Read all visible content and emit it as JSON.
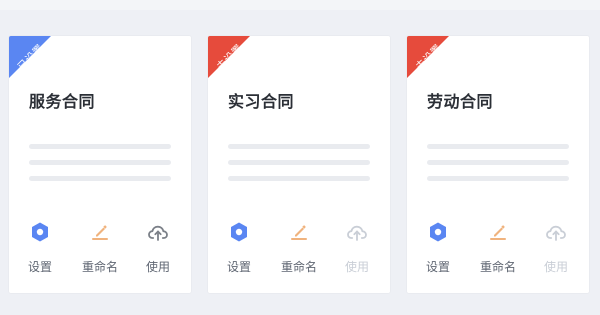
{
  "cards": [
    {
      "badge": "已设置",
      "title": "服务合同",
      "actions": {
        "settings_label": "设置",
        "rename_label": "重命名",
        "use_label": "使用"
      }
    },
    {
      "badge": "未设置",
      "title": "实习合同",
      "actions": {
        "settings_label": "设置",
        "rename_label": "重命名",
        "use_label": "使用"
      }
    },
    {
      "badge": "未设置",
      "title": "劳动合同",
      "actions": {
        "settings_label": "设置",
        "rename_label": "重命名",
        "use_label": "使用"
      }
    }
  ],
  "colors": {
    "badge_set": "#5a86f2",
    "badge_unset": "#e64b3c",
    "settings_icon": "#5a86f2",
    "rename_icon": "#f0b37e",
    "use_icon_enabled": "#7b8088",
    "use_icon_disabled": "#c9ced6"
  },
  "icons": {
    "settings": "hexagon-gear-icon",
    "rename": "pencil-icon",
    "use": "cloud-upload-icon"
  }
}
